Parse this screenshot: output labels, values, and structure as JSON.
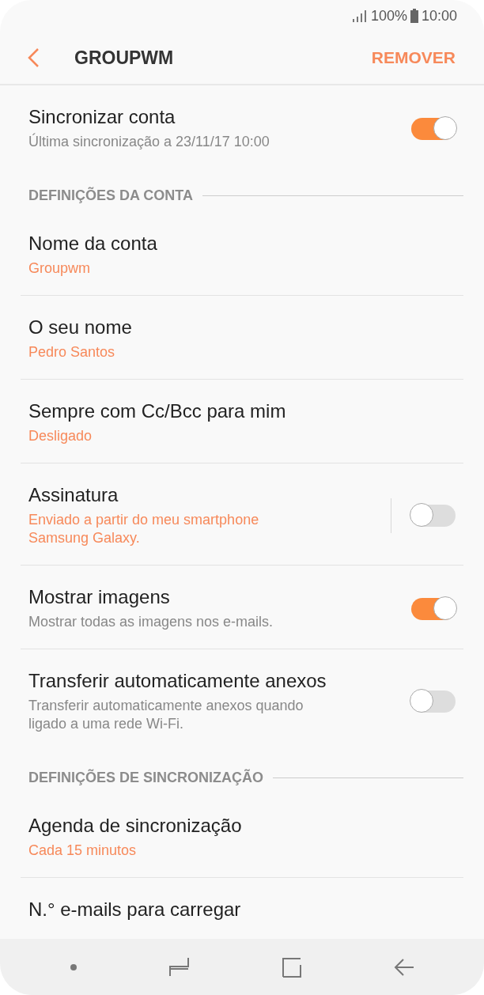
{
  "status_bar": {
    "battery": "100%",
    "time": "10:00"
  },
  "header": {
    "title": "GROUPWM",
    "action": "REMOVER"
  },
  "items": [
    {
      "kind": "toggle",
      "title": "Sincronizar conta",
      "subtitle": "Última sincronização a 23/11/17  10:00",
      "subtitle_accent": false,
      "on": true,
      "divider": false
    },
    {
      "kind": "section",
      "title": "DEFINIÇÕES DA CONTA"
    },
    {
      "kind": "value",
      "title": "Nome da conta",
      "subtitle": "Groupwm",
      "subtitle_accent": true
    },
    {
      "kind": "value",
      "title": "O seu nome",
      "subtitle": "Pedro Santos",
      "subtitle_accent": true
    },
    {
      "kind": "value",
      "title": "Sempre com Cc/Bcc para mim",
      "subtitle": "Desligado",
      "subtitle_accent": true
    },
    {
      "kind": "toggle",
      "title": "Assinatura",
      "subtitle": "Enviado a partir do meu smartphone Samsung Galaxy.",
      "subtitle_accent": true,
      "on": false,
      "divider": true
    },
    {
      "kind": "toggle",
      "title": "Mostrar imagens",
      "subtitle": "Mostrar todas as imagens nos e-mails.",
      "subtitle_accent": false,
      "on": true,
      "divider": false
    },
    {
      "kind": "toggle",
      "title": "Transferir automaticamente anexos",
      "subtitle": "Transferir automaticamente anexos quando ligado a uma rede Wi-Fi.",
      "subtitle_accent": false,
      "on": false,
      "divider": false
    },
    {
      "kind": "section",
      "title": "DEFINIÇÕES DE SINCRONIZAÇÃO"
    },
    {
      "kind": "value",
      "title": "Agenda de sincronização",
      "subtitle": "Cada 15 minutos",
      "subtitle_accent": true
    },
    {
      "kind": "value",
      "title": "N.° e-mails para carregar"
    }
  ]
}
